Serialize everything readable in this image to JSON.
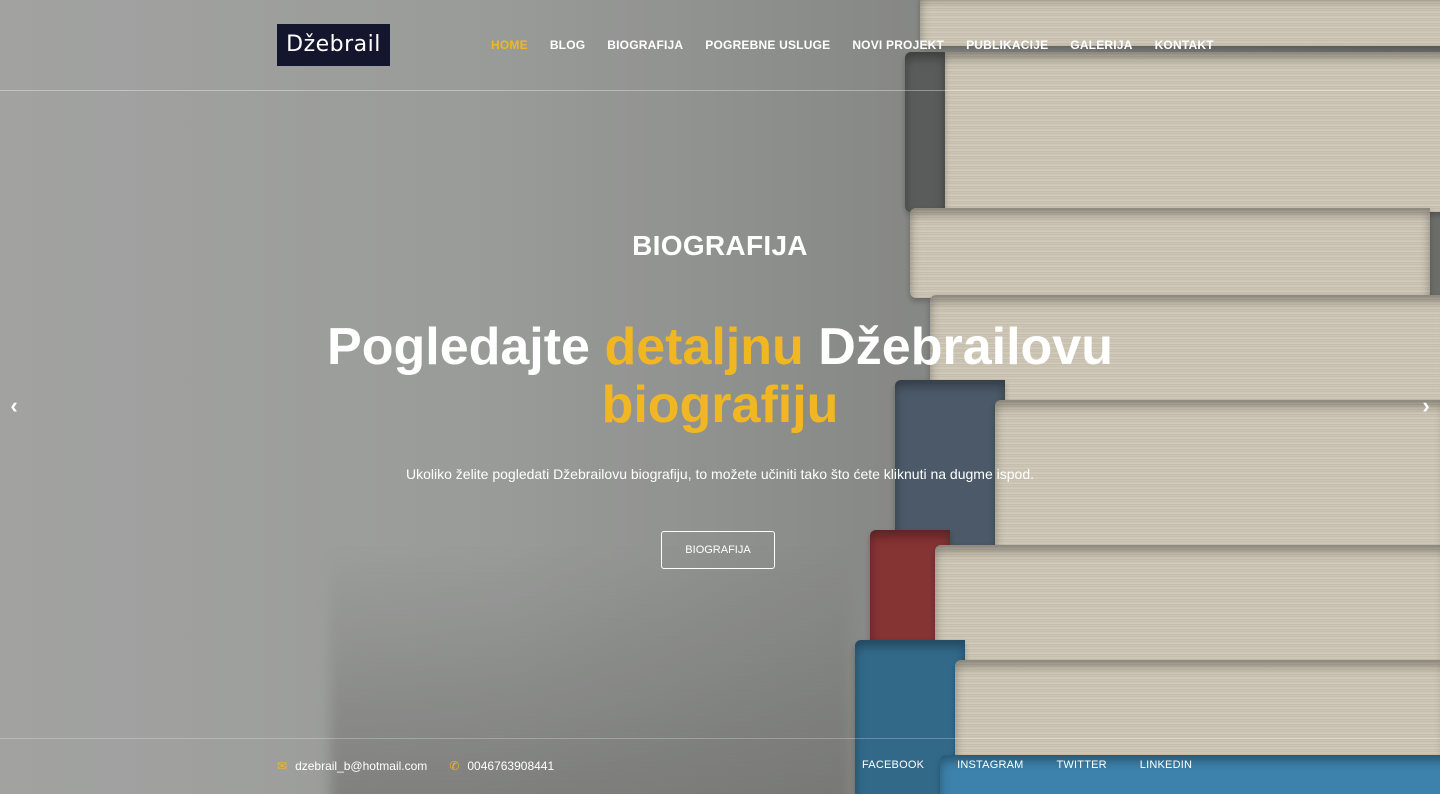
{
  "logo": {
    "text": "Džebrail"
  },
  "nav": {
    "items": [
      {
        "label": "HOME"
      },
      {
        "label": "BLOG"
      },
      {
        "label": "BIOGRAFIJA"
      },
      {
        "label": "POGREBNE USLUGE"
      },
      {
        "label": "NOVI PROJEKT"
      },
      {
        "label": "PUBLIKACIJE"
      },
      {
        "label": "GALERIJA"
      },
      {
        "label": "KONTAKT"
      }
    ],
    "active_index": 0
  },
  "hero": {
    "kicker": "BIOGRAFIJA",
    "headline": {
      "part1": "Pogledajte ",
      "part2": "detaljnu",
      "part3": " Džebrailovu ",
      "part4": "biografiju"
    },
    "subtitle": "Ukoliko želite pogledati Džebrailovu biografiju, to možete učiniti tako što ćete kliknuti na dugme ispod.",
    "button_label": "BIOGRAFIJA"
  },
  "carousel": {
    "prev_icon": "chevron-left-icon",
    "next_icon": "chevron-right-icon"
  },
  "footer": {
    "email_icon": "envelope-icon",
    "email": "dzebrail_b@hotmail.com",
    "phone_icon": "phone-icon",
    "phone": "0046763908441",
    "social": [
      {
        "label": "FACEBOOK"
      },
      {
        "label": "INSTAGRAM"
      },
      {
        "label": "TWITTER"
      },
      {
        "label": "LINKEDIN"
      }
    ]
  },
  "colors": {
    "accent": "#f0b722",
    "logo_bg": "#14162e",
    "text": "#ffffff"
  }
}
